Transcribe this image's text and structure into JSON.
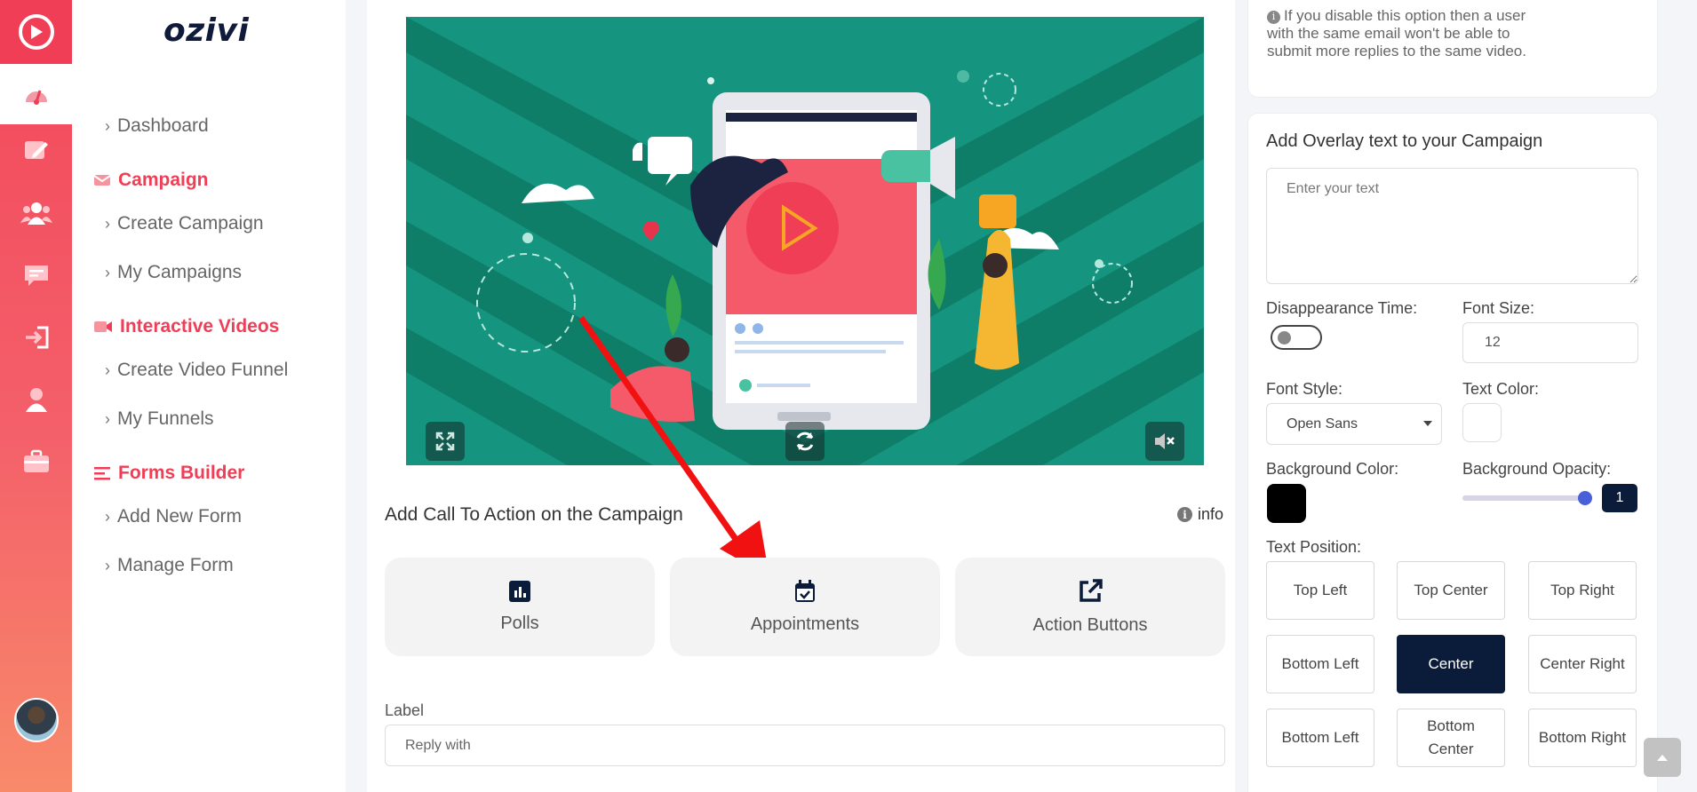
{
  "brand": "ozivi",
  "nav": {
    "dashboard": "Dashboard",
    "campaign_heading": "Campaign",
    "create_campaign": "Create Campaign",
    "my_campaigns": "My Campaigns",
    "interactive_heading": "Interactive Videos",
    "create_video_funnel": "Create Video Funnel",
    "my_funnels": "My Funnels",
    "forms_heading": "Forms Builder",
    "add_new_form": "Add New Form",
    "manage_form": "Manage Form"
  },
  "rail_icons": [
    "gauge-icon",
    "edit-icon",
    "users-icon",
    "message-icon",
    "sign-in-icon",
    "user-icon",
    "briefcase-icon"
  ],
  "main": {
    "cta_title": "Add Call To Action on the Campaign",
    "info_label": "info",
    "cta_options": [
      "Polls",
      "Appointments",
      "Action Buttons"
    ],
    "label_caption": "Label",
    "label_placeholder": "Reply with"
  },
  "right": {
    "note": "If you disable this option then a user with the same email won't be able to submit more replies to the same video.",
    "overlay_title": "Add Overlay text to your Campaign",
    "overlay_placeholder": "Enter your text",
    "disappearance_label": "Disappearance Time:",
    "disappearance_on": false,
    "font_size_label": "Font Size:",
    "font_size_value": "12",
    "font_style_label": "Font Style:",
    "font_style_value": "Open Sans",
    "text_color_label": "Text Color:",
    "text_color": "#ffffff",
    "bg_color_label": "Background Color:",
    "bg_color": "#000000",
    "bg_opacity_label": "Background Opacity:",
    "bg_opacity_value": "1",
    "text_position_label": "Text Position:",
    "positions": [
      [
        "Top Left",
        "Top Center",
        "Top Right"
      ],
      [
        "Bottom Left",
        "Center",
        "Center Right"
      ],
      [
        "Bottom Left",
        "Bottom Center",
        "Bottom Right"
      ]
    ],
    "selected_position": "Center"
  },
  "colors": {
    "accent": "#ef3e56",
    "navy": "#0b1c3a",
    "video_bg": "#15957f"
  }
}
